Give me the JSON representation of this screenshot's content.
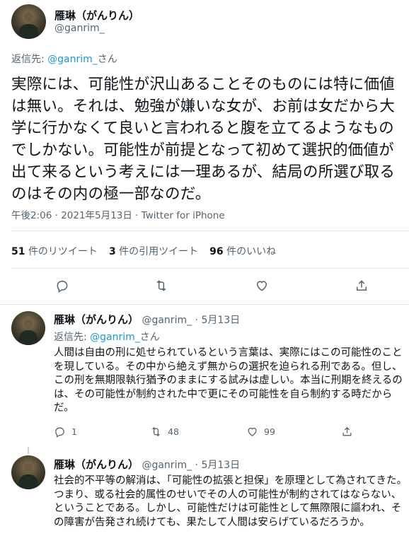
{
  "main_tweet": {
    "author_name": "雁琳（がんりん）",
    "author_handle": "@ganrim_",
    "reply_prefix": "返信先:",
    "reply_to": "@ganrim_",
    "reply_suffix": "さん",
    "text": "実際には、可能性が沢山あることそのものには特に価値は無い。それは、勉強が嫌いな女が、お前は女だから大学に行かなくて良いと言われると腹を立てるようなものでしかない。可能性が前提となって初めて選択的価値が出て来るという考えには一理あるが、結局の所選び取るのはその内の極一部なのだ。",
    "timestamp": "午後2:06 · 2021年5月13日 · Twitter for iPhone",
    "retweets_count": "51",
    "retweets_label": "件のリツイート",
    "quotes_count": "3",
    "quotes_label": "件の引用ツイート",
    "likes_count": "96",
    "likes_label": "件のいいね"
  },
  "replies": [
    {
      "author_name": "雁琳（がんりん）",
      "author_handle": "@ganrim_",
      "date": "· 5月13日",
      "reply_prefix": "返信先:",
      "reply_to": "@ganrim_",
      "reply_suffix": "さん",
      "text": "人間は自由の刑に処せられているという言葉は、実際にはこの可能性のことを現している。その中から絶えず無からの選択を迫られる刑である。但し、この刑を無期限執行猶予のままにする試みは虚しい。本当に刑期を終えるのは、その可能性が制約された中で更にその可能性を自ら制約する時だからだ。",
      "reply_count": "1",
      "retweet_count": "48",
      "like_count": "99"
    },
    {
      "author_name": "雁琳（がんりん）",
      "author_handle": "@ganrim_",
      "date": "· 5月13日",
      "text": "社会的不平等の解消は、「可能性の拡張と担保」を原理として為されてきた。つまり、或る社会的属性のせいでその人の可能性が制約されてはならない、ということである。しかし、可能性だけは可能性として無際限に謳われ、その障害が告発され続けても、果たして人間は安らげているだろうか。"
    }
  ],
  "icons": {
    "reply": "reply-icon",
    "retweet": "retweet-icon",
    "like": "heart-icon",
    "share": "share-icon"
  },
  "colors": {
    "link": "#1b95e0",
    "muted": "#536471",
    "text": "#0f1419",
    "border": "#e1e8ed"
  }
}
